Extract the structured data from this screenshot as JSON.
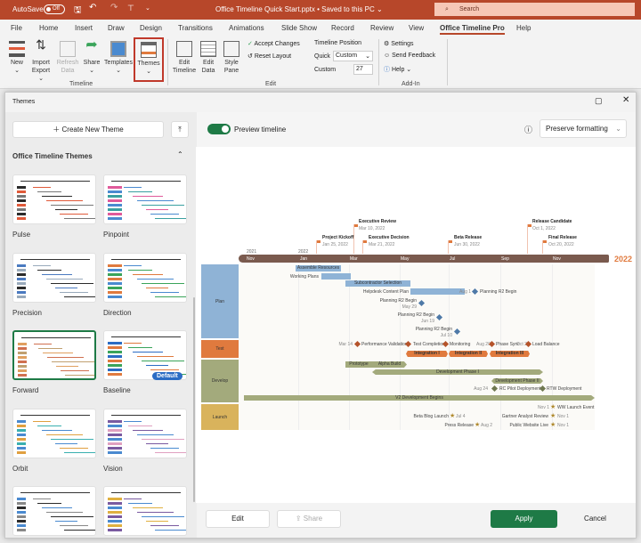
{
  "titlebar": {
    "autosave": "AutoSave",
    "autosave_state": "Off",
    "doc_title": "Office Timeline Quick Start.pptx • Saved to this PC ⌄",
    "search_placeholder": "Search"
  },
  "tabs": [
    "File",
    "Home",
    "Insert",
    "Draw",
    "Design",
    "Transitions",
    "Animations",
    "Slide Show",
    "Record",
    "Review",
    "View",
    "Office Timeline Pro",
    "Help"
  ],
  "ribbon": {
    "timeline_group": "Timeline",
    "edit_group": "Edit",
    "addin_group": "Add-In",
    "new": "New",
    "import": "Import",
    "export": "Export ⌄",
    "refresh": "Refresh",
    "refresh2": "Data",
    "share": "Share",
    "templates": "Templates",
    "themes": "Themes",
    "edit_timeline": "Edit",
    "edit_timeline2": "Timeline",
    "edit_data": "Edit",
    "edit_data2": "Data",
    "style_pane": "Style",
    "style_pane2": "Pane",
    "accept_changes": "Accept Changes",
    "reset_layout": "Reset Layout",
    "timeline_position": "Timeline Position",
    "quick": "Quick",
    "quick_value": "Custom",
    "custom": "Custom",
    "custom_value": "27",
    "settings": "Settings",
    "send_feedback": "Send Feedback",
    "help": "Help ⌄"
  },
  "dialog": {
    "title": "Themes",
    "create_new_theme": "Create New Theme",
    "section": "Office Timeline Themes",
    "preview_timeline": "Preview timeline",
    "preserve_formatting": "Preserve formatting",
    "edit": "Edit",
    "share": "Share",
    "apply": "Apply",
    "cancel": "Cancel",
    "default_badge": "Default",
    "themes": [
      "Pulse",
      "Pinpoint",
      "Precision",
      "Direction",
      "Forward",
      "Baseline",
      "Orbit",
      "Vision",
      "",
      ""
    ],
    "selected": "Forward"
  },
  "timeline": {
    "year_label": "2022",
    "years": [
      "2021",
      "2022"
    ],
    "months": [
      "Nov",
      "Jan",
      "Mar",
      "May",
      "Jul",
      "Sep",
      "Nov"
    ],
    "milestones": [
      {
        "t": "Executive Review",
        "d": "Mar 10, 2022"
      },
      {
        "t": "Release Candidate",
        "d": "Oct 1, 2022"
      },
      {
        "t": "Project Kickoff",
        "d": "Jan 25, 2022"
      },
      {
        "t": "Executive Decision",
        "d": "Mar 21, 2022"
      },
      {
        "t": "Beta Release",
        "d": "Jun 30, 2022"
      },
      {
        "t": "Final Release",
        "d": "Oct 20, 2022"
      }
    ],
    "lanes": [
      "Plan",
      "Test",
      "Develop",
      "Launch"
    ],
    "plan": {
      "assemble": "Assemble Resources",
      "working": "Working Plans",
      "subcontractor": "Subcontractor Selection",
      "helpdesk": "Helpdesk Content Plan",
      "aug1": "Aug 1",
      "p1": "Planning R2 Begin",
      "p2": "Planning R2 Begin",
      "p2d": "May 29",
      "p3": "Planning R2 Begin",
      "p3d": "Jun 19",
      "p4": "Planning R2 Begin",
      "p4d": "Jul 10"
    },
    "test": {
      "mar14": "Mar 14",
      "perf": "Performance Validation",
      "testc": "Test Completion",
      "mon": "Monitoring",
      "aug20": "Aug 20",
      "sync": "Phase Sync",
      "oct2": "Oct 2",
      "load": "Load Balance",
      "i1": "Integration I",
      "i2": "Integration II",
      "i3": "Integration III"
    },
    "develop": {
      "proto": "Prototype",
      "alpha": "Alpha Build",
      "dp1": "Development Phase I",
      "dp2": "Development Phase II",
      "aug24": "Aug 24",
      "rc": "RC Pilot Deployment",
      "rtw": "RTW Deployment",
      "v2": "V2 Development Begins"
    },
    "launch": {
      "nov1a": "Nov 1",
      "ww": "WW Launch Event",
      "beta": "Beta Blog Launch",
      "jul4": "Jul 4",
      "gartner": "Gartner Analyst Review",
      "nov1b": "Nov 1",
      "press": "Press Release",
      "aug2": "Aug 2",
      "public": "Public Website Live",
      "nov1c": "Nov 1"
    }
  },
  "colors": {
    "brand": "#b7472a",
    "plan": "#8fb3d6",
    "test": "#e07a3e",
    "develop": "#a3aa7c",
    "launch": "#d9b35c",
    "scale": "#7a5a4e",
    "apply": "#1e7a46"
  }
}
